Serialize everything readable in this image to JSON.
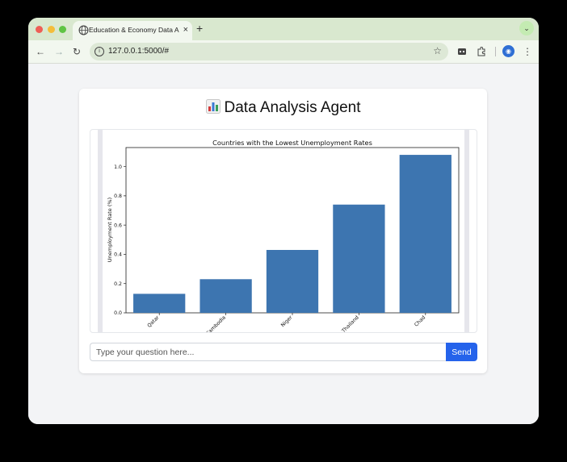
{
  "browser": {
    "tab_title": "Education & Economy Data A",
    "tab_close": "×",
    "new_tab": "+",
    "tab_menu": "⌄",
    "url": "127.0.0.1:5000/#",
    "back": "←",
    "forward": "→",
    "reload": "↻",
    "info": "i",
    "star": "☆",
    "kebab": "⋮",
    "icons": [
      "globe-icon",
      "info-icon",
      "star-icon",
      "extension-icon",
      "puzzle-icon",
      "profile-icon",
      "kebab-icon"
    ]
  },
  "app": {
    "title": "Data Analysis Agent",
    "title_icon": "bar-chart-icon"
  },
  "chat": {
    "placeholder": "Type your question here...",
    "value": "",
    "send_label": "Send"
  },
  "colors": {
    "bar": "#3d75b0",
    "send": "#2563eb",
    "tab_strip": "#d9e8cf"
  },
  "chart_data": {
    "type": "bar",
    "title": "Countries with the Lowest Unemployment Rates",
    "xlabel": "",
    "ylabel": "Unemployment Rate (%)",
    "categories": [
      "Qatar",
      "Cambodia",
      "Niger",
      "Thailand",
      "Chad"
    ],
    "values": [
      0.13,
      0.23,
      0.43,
      0.74,
      1.08
    ],
    "yticks": [
      "0.0",
      "0.2",
      "0.4",
      "0.6",
      "0.8",
      "1.0"
    ],
    "ylim": [
      0,
      1.13
    ],
    "grid": false,
    "legend": "none"
  }
}
